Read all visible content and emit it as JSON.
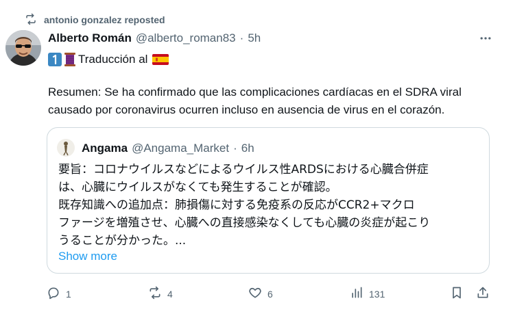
{
  "repost": {
    "text": "antonio gonzalez reposted"
  },
  "post": {
    "author_name": "Alberto Román",
    "handle": "@alberto_roman83",
    "separator": "·",
    "time": "5h",
    "line1_text": "Traducción al",
    "paragraph": "Resumen: Se ha confirmado que las complicaciones cardíacas en el SDRA viral causado por coronavirus ocurren incluso en ausencia de virus en el corazón."
  },
  "quote": {
    "author_name": "Angama",
    "handle": "@Angama_Market",
    "separator": "·",
    "time": "6h",
    "lines": [
      "要旨：コロナウイルスなどによるウイルス性ARDSにおける心臓合併症",
      "は、心臓にウイルスがなくても発生することが確認。",
      "既存知識への追加点：肺損傷に対する免疫系の反応がCCR2+マクロ",
      "ファージを増殖させ、心臓への直接感染なくしても心臓の炎症が起こり",
      "うることが分かった。..."
    ],
    "show_more": "Show more"
  },
  "actions": {
    "replies": "1",
    "reposts": "4",
    "likes": "6",
    "views": "131"
  },
  "icons": {
    "repost": "repost-icon",
    "more": "more-dots-icon",
    "keycap": "keycap-one-emoji",
    "spool": "thread-spool-emoji",
    "flag": "spain-flag-emoji",
    "reply": "reply-icon",
    "like": "heart-icon",
    "views": "views-chart-icon",
    "bookmark": "bookmark-icon",
    "share": "share-icon"
  },
  "colors": {
    "text": "#0f1419",
    "muted": "#536471",
    "link": "#1d9bf0",
    "border": "#cfd9de"
  }
}
